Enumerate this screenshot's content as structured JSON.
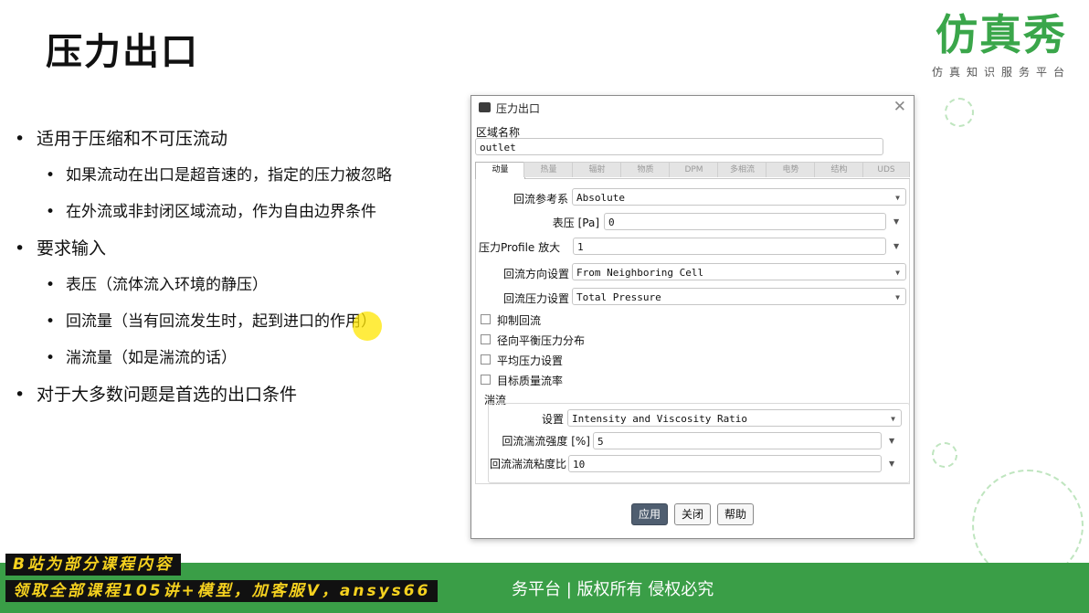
{
  "slide": {
    "title": "压力出口",
    "logo": {
      "main": "仿真秀",
      "sub": "仿真知识服务平台"
    },
    "bullets": [
      "适用于压缩和不可压流动",
      "如果流动在出口是超音速的，指定的压力被忽略",
      "在外流或非封闭区域流动，作为自由边界条件",
      "要求输入",
      "表压（流体流入环境的静压）",
      "回流量（当有回流发生时，起到进口的作用）",
      "湍流量（如是湍流的话）",
      "对于大多数问题是首选的出口条件"
    ]
  },
  "dialog": {
    "title": "压力出口",
    "close_icon": "close-icon",
    "zone_label": "区域名称",
    "zone_value": "outlet",
    "tabs": [
      "动量",
      "热量",
      "辐射",
      "物质",
      "DPM",
      "多相流",
      "电势",
      "结构",
      "UDS"
    ],
    "active_tab": "动量",
    "fields": {
      "backflow_ref_label": "回流参考系",
      "backflow_ref_value": "Absolute",
      "gauge_label": "表压 [Pa]",
      "gauge_value": "0",
      "profile_label": "压力Profile 放大",
      "profile_value": "1",
      "backflow_dir_label": "回流方向设置",
      "backflow_dir_value": "From Neighboring Cell",
      "backflow_press_label": "回流压力设置",
      "backflow_press_value": "Total Pressure"
    },
    "checkboxes": [
      "抑制回流",
      "径向平衡压力分布",
      "平均压力设置",
      "目标质量流率"
    ],
    "turbulence": {
      "group_label": "湍流",
      "method_label": "设置",
      "method_value": "Intensity and Viscosity Ratio",
      "intensity_label": "回流湍流强度 [%]",
      "intensity_value": "5",
      "viscosity_label": "回流湍流粘度比",
      "viscosity_value": "10"
    },
    "buttons": {
      "apply": "应用",
      "close": "关闭",
      "help": "帮助"
    }
  },
  "footer": {
    "text": "务平台 | 版权所有 侵权必究",
    "promo1": "B站为部分课程内容",
    "promo2": "领取全部课程105讲+模型，加客服V，ansys66"
  },
  "colors": {
    "brand_green": "#3a9e47",
    "promo_yellow": "#f6d21f",
    "apply_button": "#4f5e70",
    "cursor_highlight": "#ffe600"
  }
}
